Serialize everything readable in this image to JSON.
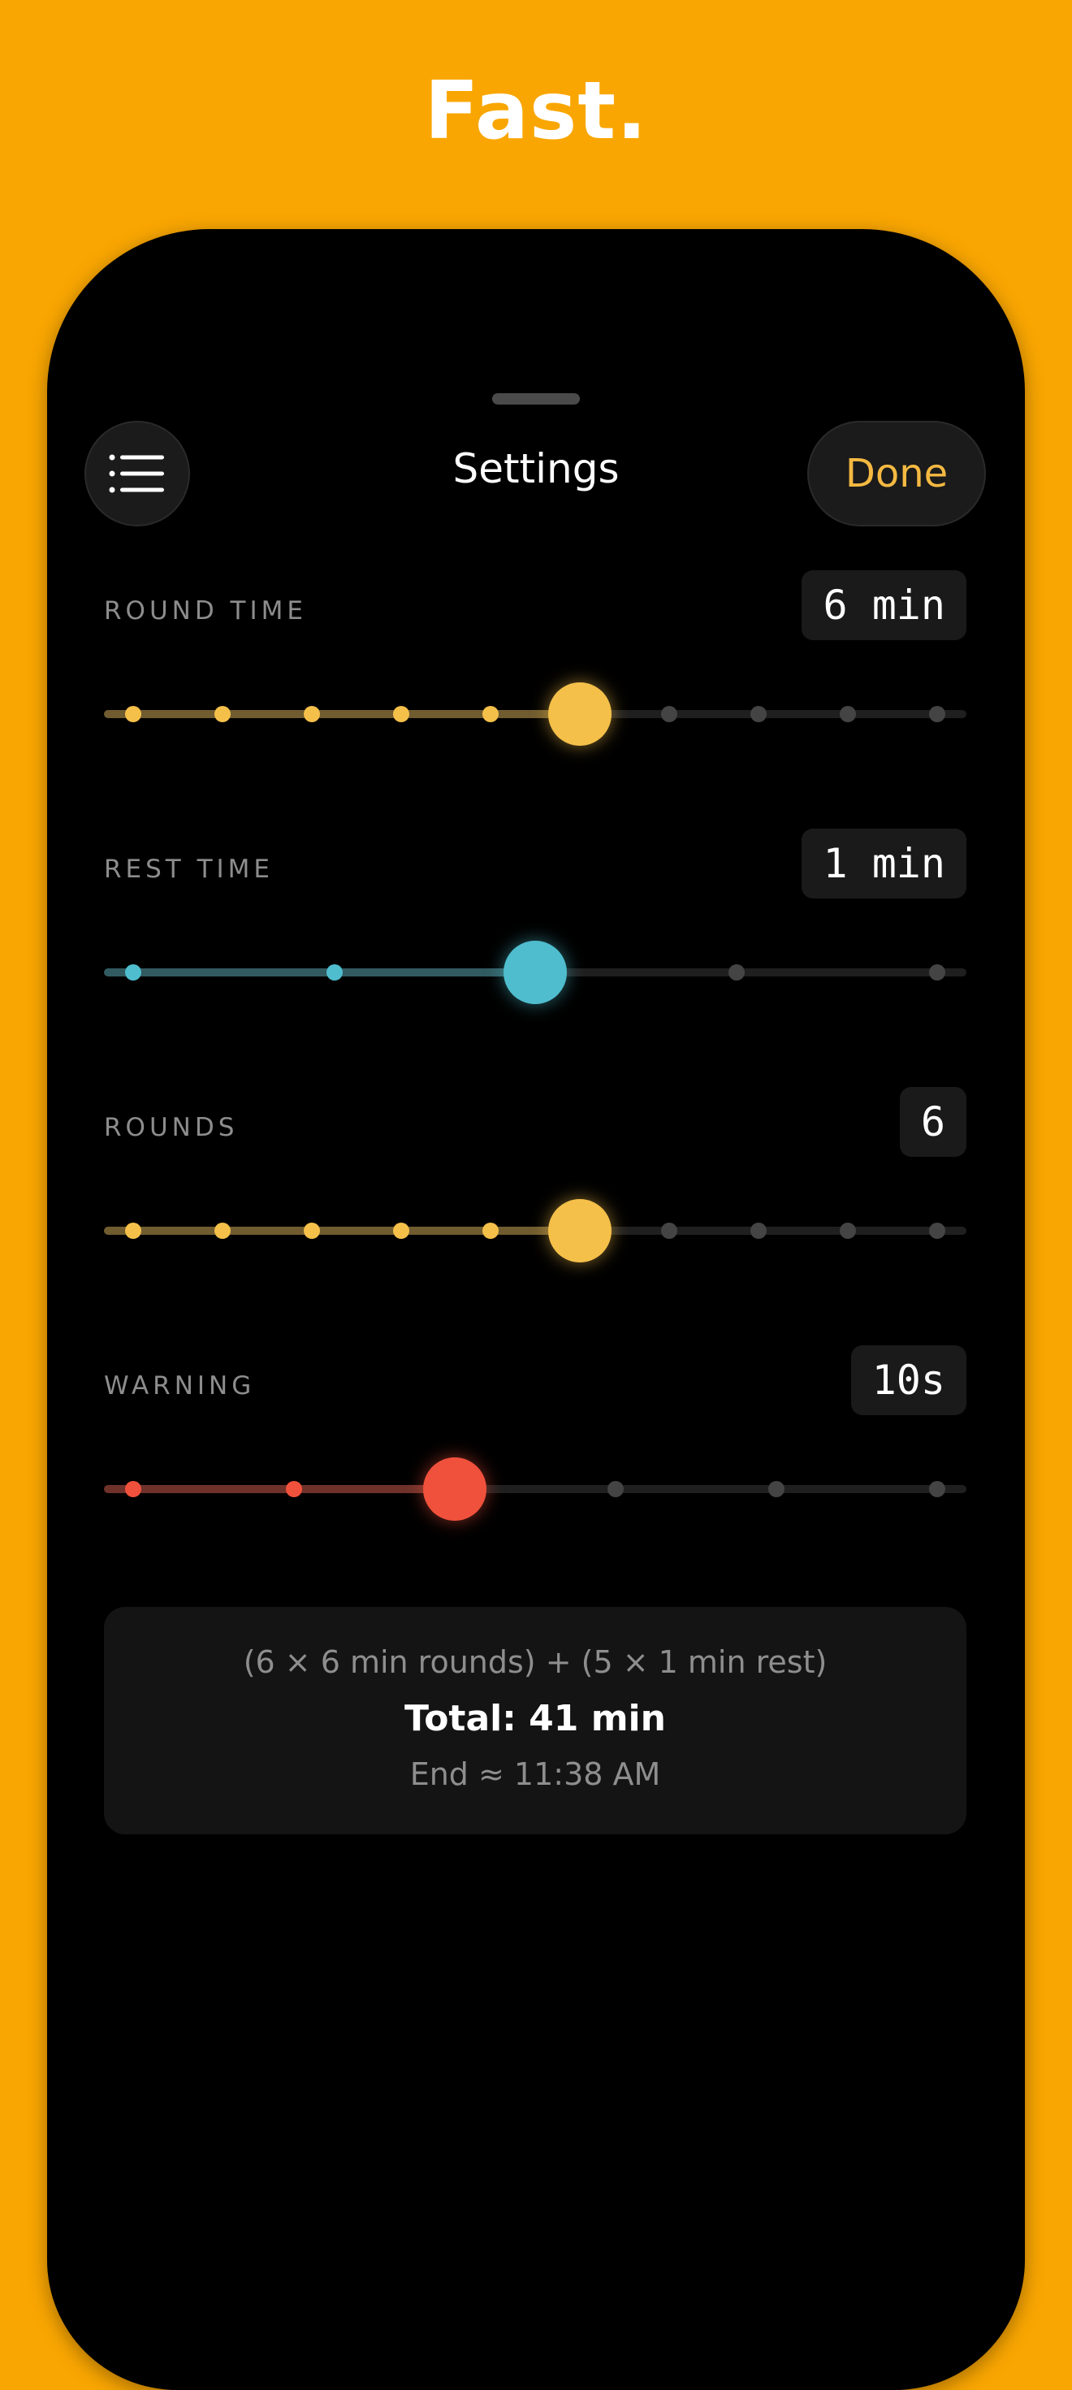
{
  "headline": "Fast.",
  "header": {
    "menu_icon": "list-icon",
    "title": "Settings",
    "done_label": "Done"
  },
  "colors": {
    "background": "#F9A602",
    "round_accent": "#F5C04A",
    "rest_accent": "#4FBDCE",
    "warning_accent": "#F0513C",
    "done_text": "#F5B942"
  },
  "settings": {
    "round_time": {
      "label": "ROUND TIME",
      "value": "6 min",
      "stops": 10,
      "selected_index": 5
    },
    "rest_time": {
      "label": "REST TIME",
      "value": "1 min",
      "stops": 5,
      "selected_index": 2
    },
    "rounds": {
      "label": "ROUNDS",
      "value": "6",
      "stops": 10,
      "selected_index": 5
    },
    "warning": {
      "label": "WARNING",
      "value": "10s",
      "stops": 6,
      "selected_index": 2
    }
  },
  "summary": {
    "formula": "(6 × 6 min rounds) + (5 × 1 min rest)",
    "total": "Total: 41 min",
    "end": "End ≈ 11:38 AM"
  }
}
